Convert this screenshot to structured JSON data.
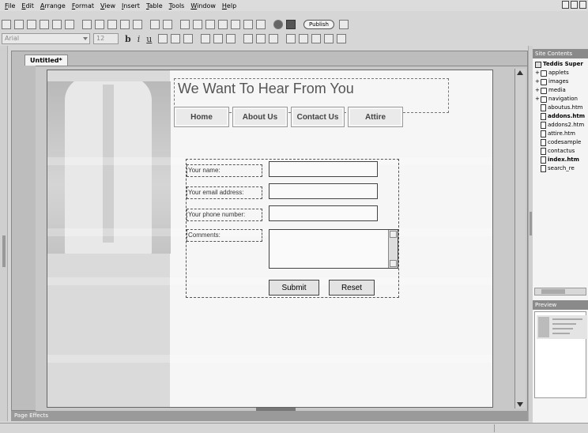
{
  "menu": [
    "File",
    "Edit",
    "Arrange",
    "Format",
    "View",
    "Insert",
    "Table",
    "Tools",
    "Window",
    "Help"
  ],
  "toolbar": {
    "publish_label": "Publish"
  },
  "format_bar": {
    "font_value": "Arial",
    "size_value": "12",
    "bold_label": "b",
    "italic_label": "i",
    "underline_label": "u"
  },
  "document": {
    "tab_label": "Untitled*"
  },
  "page": {
    "heading": "We Want To Hear From You",
    "nav": [
      "Home",
      "About Us",
      "Contact Us",
      "Attire"
    ],
    "form": {
      "name_label": "Your name:",
      "email_label": "Your email address:",
      "phone_label": "Your phone number:",
      "comments_label": "Comments:",
      "submit_label": "Submit",
      "reset_label": "Reset"
    }
  },
  "effects_label": "Page Effects",
  "site_contents": {
    "title": "Site Contents",
    "site_name": "Teddis Super",
    "folders": [
      "applets",
      "images",
      "media",
      "navigation"
    ],
    "files": [
      "aboutus.htm",
      "addons.htm",
      "addons2.htm",
      "attire.htm",
      "codesample",
      "contactus",
      "index.htm",
      "search_re"
    ]
  },
  "preview": {
    "title": "Preview"
  }
}
